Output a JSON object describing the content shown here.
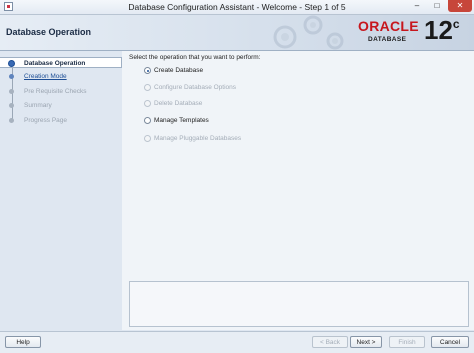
{
  "window": {
    "title": "Database Configuration Assistant - Welcome - Step 1 of 5",
    "minimize_glyph": "–",
    "maximize_glyph": "□",
    "close_glyph": "✕"
  },
  "header": {
    "step_title": "Database Operation",
    "logo_text": "ORACLE",
    "logo_sub": "DATABASE",
    "version": "12",
    "version_sup": "c"
  },
  "sidebar": {
    "items": [
      {
        "label": "Database Operation",
        "state": "active"
      },
      {
        "label": "Creation Mode",
        "state": "link"
      },
      {
        "label": "Pre Requisite Checks",
        "state": "disabled"
      },
      {
        "label": "Summary",
        "state": "disabled"
      },
      {
        "label": "Progress Page",
        "state": "disabled"
      }
    ]
  },
  "main": {
    "prompt": "Select the operation that you want to perform:",
    "options": [
      {
        "label": "Create Database",
        "selected": true,
        "enabled": true
      },
      {
        "label": "Configure Database Options",
        "selected": false,
        "enabled": false
      },
      {
        "label": "Delete Database",
        "selected": false,
        "enabled": false
      },
      {
        "label": "Manage Templates",
        "selected": false,
        "enabled": true
      },
      {
        "label": "Manage Pluggable Databases",
        "selected": false,
        "enabled": false
      }
    ]
  },
  "footer": {
    "help": "Help",
    "back": "< Back",
    "next": "Next >",
    "finish": "Finish",
    "cancel": "Cancel"
  },
  "colors": {
    "oracle_red": "#c7161d",
    "accent_blue": "#1d4e95"
  }
}
